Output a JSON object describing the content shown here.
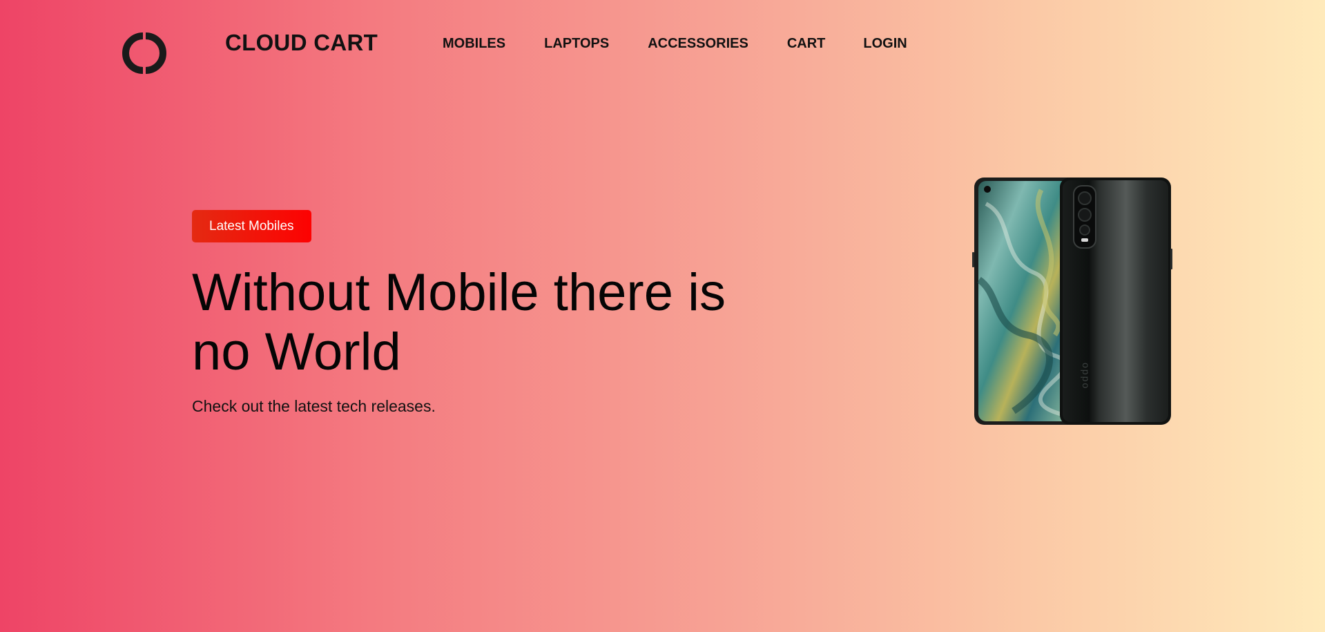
{
  "header": {
    "logo_icon": "double-c-logo-icon",
    "brand": "CLOUD CART",
    "nav": [
      {
        "label": "MOBILES"
      },
      {
        "label": "LAPTOPS"
      },
      {
        "label": "ACCESSORIES"
      },
      {
        "label": "CART"
      },
      {
        "label": "LOGIN"
      }
    ]
  },
  "hero": {
    "badge_label": "Latest Mobiles",
    "headline": "Without Mobile there is no World",
    "subtext": "Check out the latest tech releases.",
    "image_icon": "smartphone-image",
    "phone_brand_text": "oppo"
  },
  "colors": {
    "gradient_start": "#ee4466",
    "gradient_end": "#ffeabb",
    "badge": "#f20a06",
    "text": "#111111"
  }
}
